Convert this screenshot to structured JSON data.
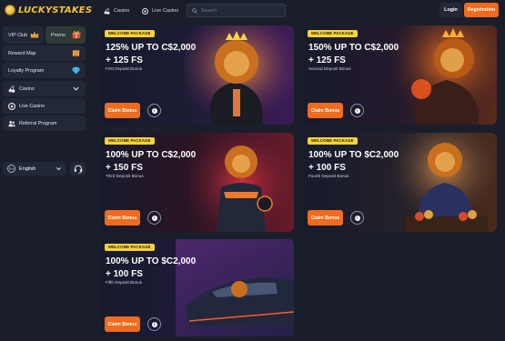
{
  "header": {
    "brand": "LUCKYSTAKES",
    "nav": [
      {
        "label": "Casino",
        "icon": "cherries-icon"
      },
      {
        "label": "Live Casino",
        "icon": "chip-icon"
      }
    ],
    "search_placeholder": "Search",
    "login_label": "Login",
    "register_label": "Registration"
  },
  "sidebar": {
    "vip_label": "VIP Club",
    "promo_label": "Promo",
    "items": [
      {
        "label": "Reward Map"
      },
      {
        "label": "Loyalty Program"
      },
      {
        "label": "Casino"
      },
      {
        "label": "Live Casino"
      },
      {
        "label": "Referral Program"
      }
    ],
    "language": "English"
  },
  "colors": {
    "accent": "#ef6b1e",
    "tag": "#f8d23a",
    "brand": "#f4c430",
    "background": "#1a1e2b"
  },
  "promos": [
    {
      "tag": "WELCOME PACKAGE",
      "line1": "125% UP TO C$2,000",
      "line2": "+ 125 FS",
      "sub": "First Deposit Bonus",
      "button": "Claim Bonus"
    },
    {
      "tag": "WELCOME PACKAGE",
      "line1": "150% UP TO C$2,000",
      "line2": "+ 125 FS",
      "sub": "Second Deposit Bonus",
      "button": "Claim Bonus"
    },
    {
      "tag": "WELCOME PACKAGE",
      "line1": "100% UP TO C$2,000",
      "line2": "+ 150 FS",
      "sub": "Third Deposit Bonus",
      "button": "Claim Bonus"
    },
    {
      "tag": "WELCOME PACKAGE",
      "line1": "100% UP TO $C2,000",
      "line2": "+ 100 FS",
      "sub": "Fourth Deposit Bonus",
      "button": "Claim Bonus"
    },
    {
      "tag": "WELCOME PACKAGE",
      "line1": "100% UP TO $C2,000",
      "line2": "+ 100 FS",
      "sub": "Fifth Deposit Bonus",
      "button": "Claim Bonus"
    }
  ]
}
